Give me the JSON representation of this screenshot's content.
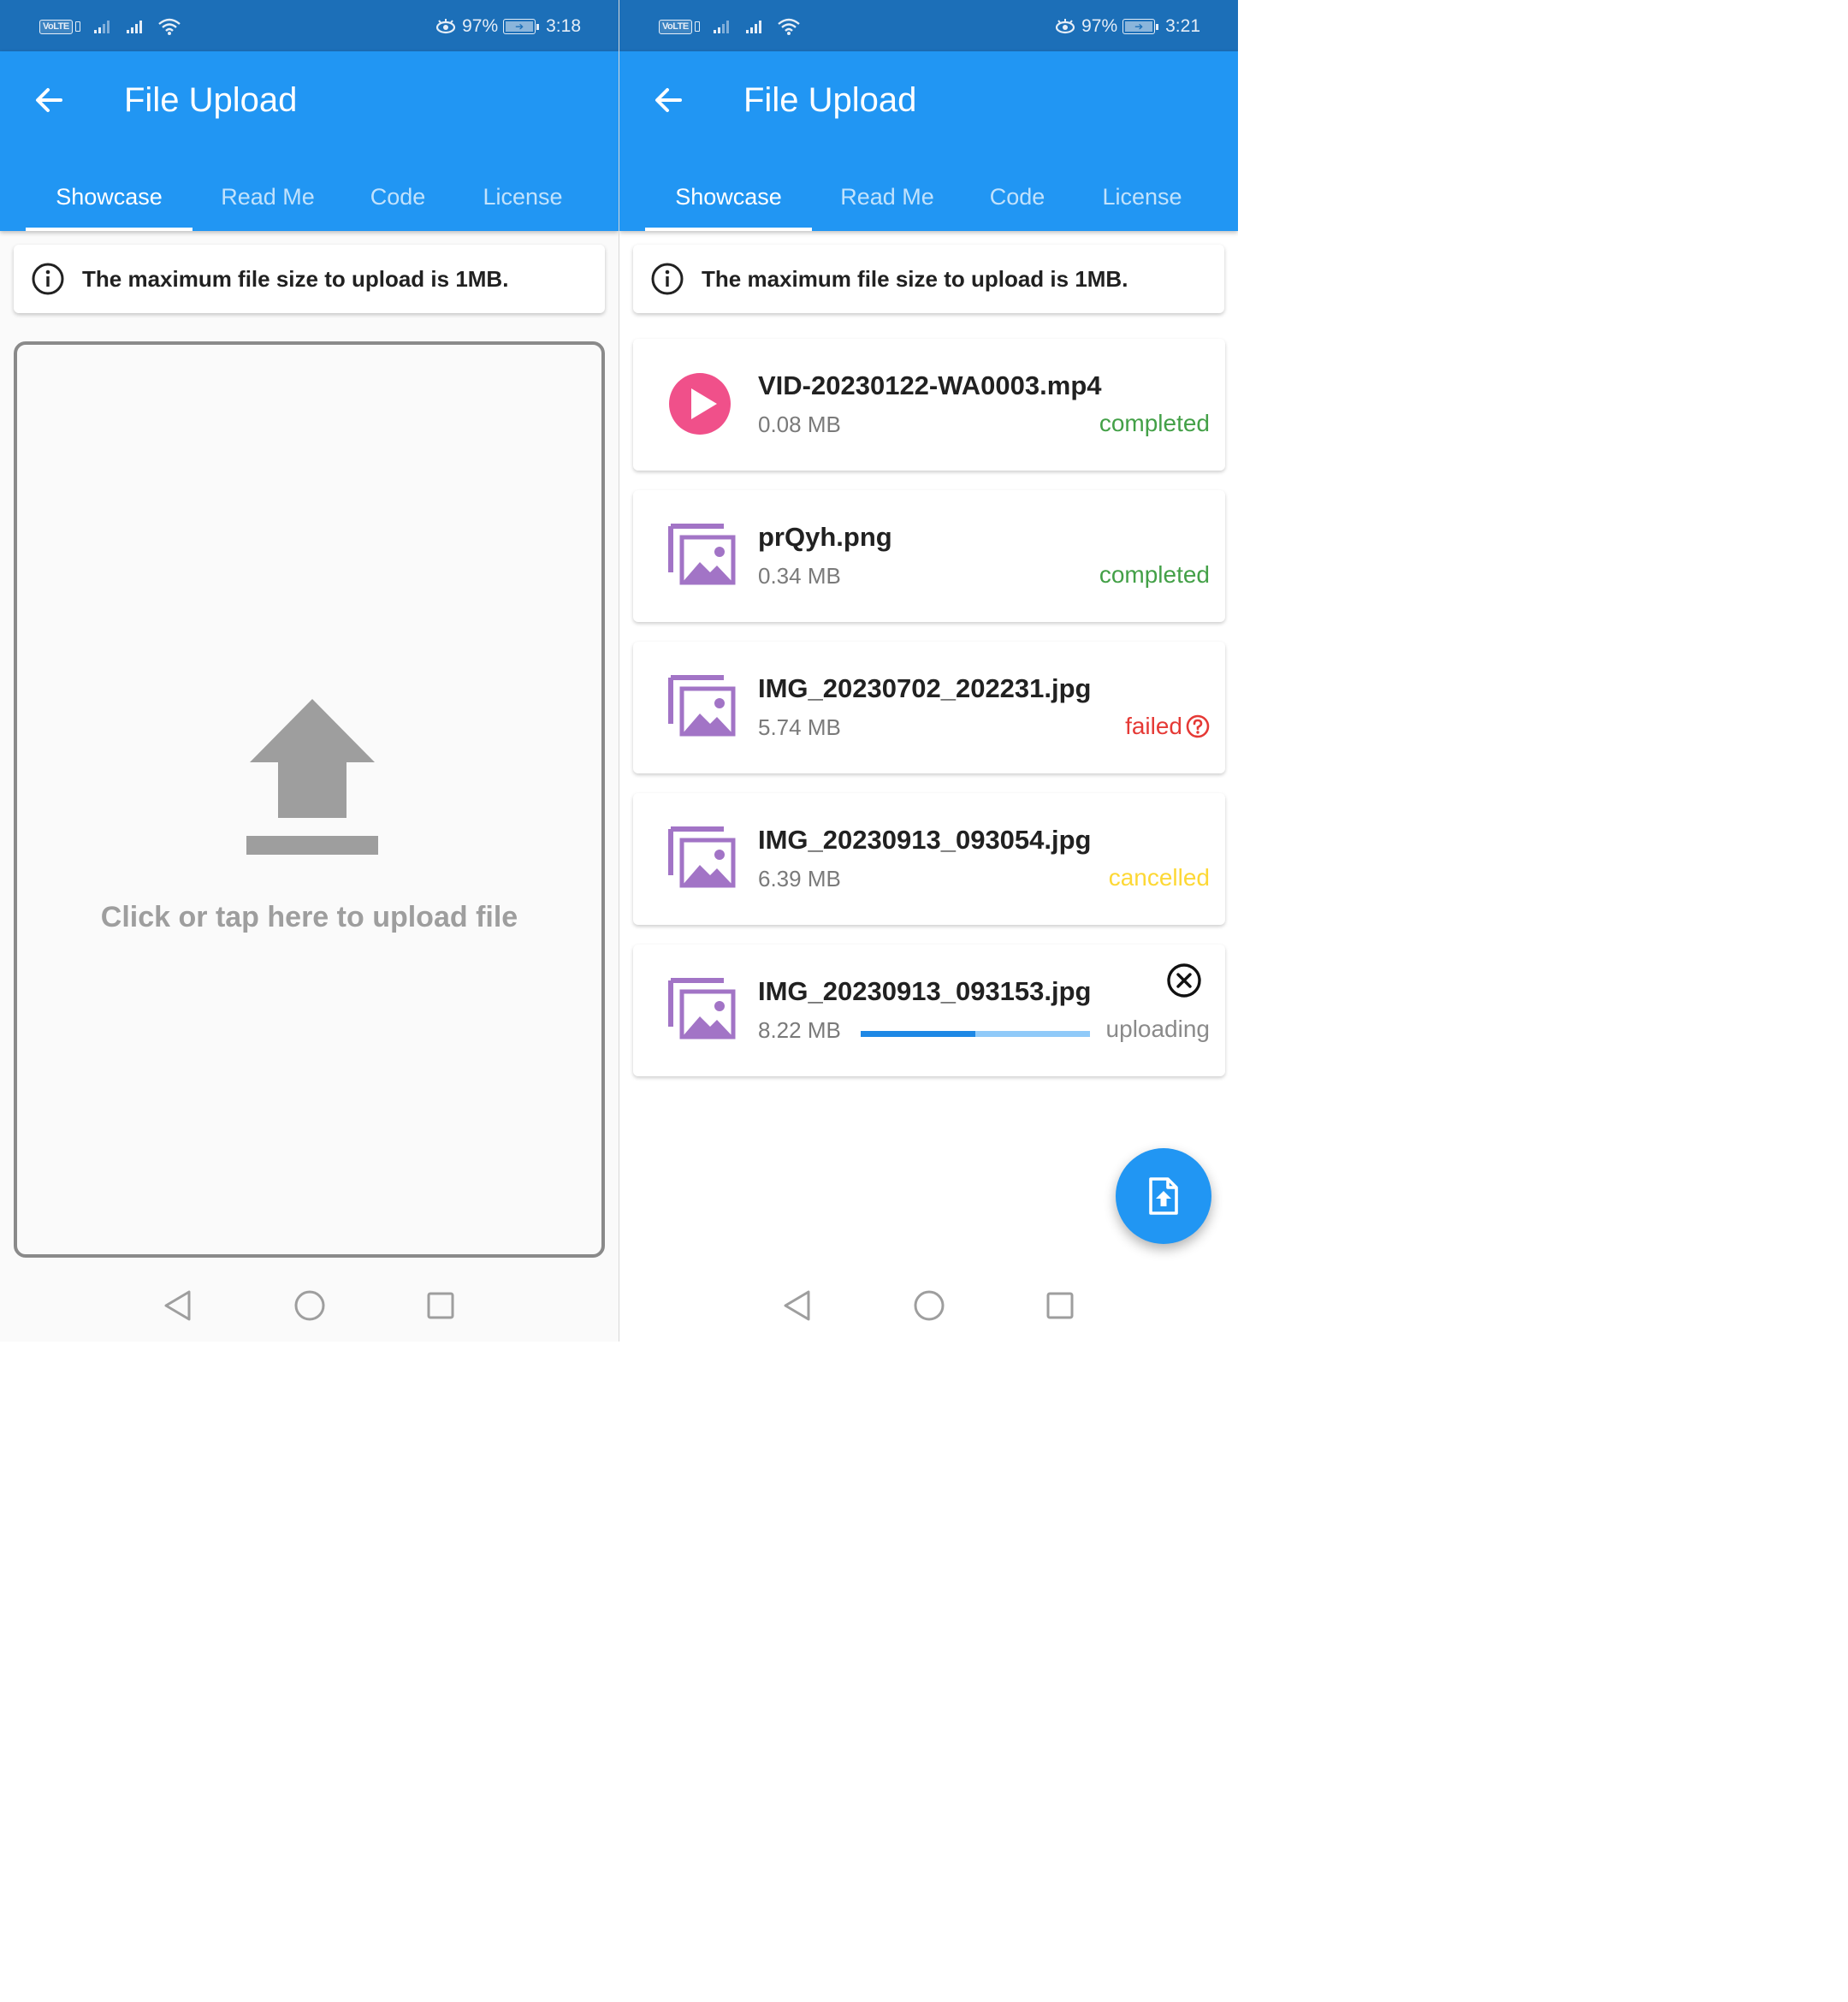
{
  "colors": {
    "status_bar": "#1c6fb8",
    "app_bar": "#2196f3",
    "completed": "#43a047",
    "failed": "#e53935",
    "cancelled": "#fdd835",
    "uploading": "#8a8a8a",
    "video_icon": "#f0508a",
    "image_icon": "#a274c6"
  },
  "left": {
    "status_bar": {
      "volte": "VoLTE",
      "battery": "97%",
      "time": "3:18"
    },
    "app_bar": {
      "title": "File Upload",
      "back_icon": "arrow-left-icon"
    },
    "tabs": [
      {
        "label": "Showcase",
        "active": true
      },
      {
        "label": "Read Me",
        "active": false
      },
      {
        "label": "Code",
        "active": false
      },
      {
        "label": "License",
        "active": false
      }
    ],
    "info": {
      "icon": "info-icon",
      "text": "The maximum file size to upload is 1MB."
    },
    "upload_area": {
      "icon": "upload-icon",
      "text": "Click or tap here to upload file"
    },
    "nav": {
      "back": "triangle-back-icon",
      "home": "circle-home-icon",
      "recents": "square-recents-icon"
    }
  },
  "right": {
    "status_bar": {
      "volte": "VoLTE",
      "battery": "97%",
      "time": "3:21"
    },
    "app_bar": {
      "title": "File Upload",
      "back_icon": "arrow-left-icon"
    },
    "tabs": [
      {
        "label": "Showcase",
        "active": true
      },
      {
        "label": "Read Me",
        "active": false
      },
      {
        "label": "Code",
        "active": false
      },
      {
        "label": "License",
        "active": false
      }
    ],
    "info": {
      "icon": "info-icon",
      "text": "The maximum file size to upload is 1MB."
    },
    "files": [
      {
        "name": "VID-20230122-WA0003.mp4",
        "size": "0.08 MB",
        "status": "completed",
        "icon": "video-play-icon"
      },
      {
        "name": "prQyh.png",
        "size": "0.34 MB",
        "status": "completed",
        "icon": "image-stack-icon"
      },
      {
        "name": "IMG_20230702_202231.jpg",
        "size": "5.74 MB",
        "status": "failed",
        "icon": "image-stack-icon"
      },
      {
        "name": "IMG_20230913_093054.jpg",
        "size": "6.39 MB",
        "status": "cancelled",
        "icon": "image-stack-icon"
      },
      {
        "name": "IMG_20230913_093153.jpg",
        "size": "8.22 MB",
        "status": "uploading",
        "icon": "image-stack-icon",
        "progress": 0.5
      }
    ],
    "fab": {
      "icon": "file-upload-icon"
    },
    "nav": {
      "back": "triangle-back-icon",
      "home": "circle-home-icon",
      "recents": "square-recents-icon"
    }
  }
}
